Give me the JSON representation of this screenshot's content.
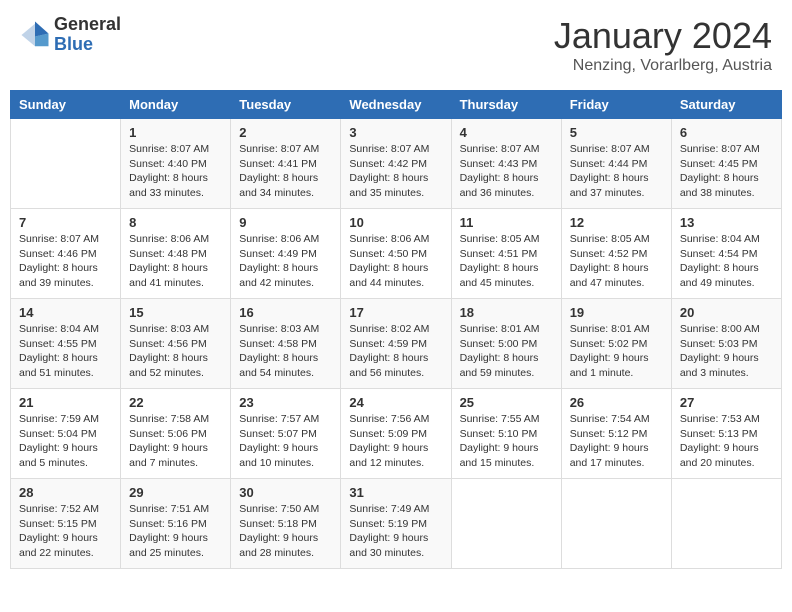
{
  "logo": {
    "general": "General",
    "blue": "Blue"
  },
  "title": "January 2024",
  "location": "Nenzing, Vorarlberg, Austria",
  "headers": [
    "Sunday",
    "Monday",
    "Tuesday",
    "Wednesday",
    "Thursday",
    "Friday",
    "Saturday"
  ],
  "weeks": [
    [
      {
        "day": "",
        "sunrise": "",
        "sunset": "",
        "daylight": ""
      },
      {
        "day": "1",
        "sunrise": "Sunrise: 8:07 AM",
        "sunset": "Sunset: 4:40 PM",
        "daylight": "Daylight: 8 hours and 33 minutes."
      },
      {
        "day": "2",
        "sunrise": "Sunrise: 8:07 AM",
        "sunset": "Sunset: 4:41 PM",
        "daylight": "Daylight: 8 hours and 34 minutes."
      },
      {
        "day": "3",
        "sunrise": "Sunrise: 8:07 AM",
        "sunset": "Sunset: 4:42 PM",
        "daylight": "Daylight: 8 hours and 35 minutes."
      },
      {
        "day": "4",
        "sunrise": "Sunrise: 8:07 AM",
        "sunset": "Sunset: 4:43 PM",
        "daylight": "Daylight: 8 hours and 36 minutes."
      },
      {
        "day": "5",
        "sunrise": "Sunrise: 8:07 AM",
        "sunset": "Sunset: 4:44 PM",
        "daylight": "Daylight: 8 hours and 37 minutes."
      },
      {
        "day": "6",
        "sunrise": "Sunrise: 8:07 AM",
        "sunset": "Sunset: 4:45 PM",
        "daylight": "Daylight: 8 hours and 38 minutes."
      }
    ],
    [
      {
        "day": "7",
        "sunrise": "Sunrise: 8:07 AM",
        "sunset": "Sunset: 4:46 PM",
        "daylight": "Daylight: 8 hours and 39 minutes."
      },
      {
        "day": "8",
        "sunrise": "Sunrise: 8:06 AM",
        "sunset": "Sunset: 4:48 PM",
        "daylight": "Daylight: 8 hours and 41 minutes."
      },
      {
        "day": "9",
        "sunrise": "Sunrise: 8:06 AM",
        "sunset": "Sunset: 4:49 PM",
        "daylight": "Daylight: 8 hours and 42 minutes."
      },
      {
        "day": "10",
        "sunrise": "Sunrise: 8:06 AM",
        "sunset": "Sunset: 4:50 PM",
        "daylight": "Daylight: 8 hours and 44 minutes."
      },
      {
        "day": "11",
        "sunrise": "Sunrise: 8:05 AM",
        "sunset": "Sunset: 4:51 PM",
        "daylight": "Daylight: 8 hours and 45 minutes."
      },
      {
        "day": "12",
        "sunrise": "Sunrise: 8:05 AM",
        "sunset": "Sunset: 4:52 PM",
        "daylight": "Daylight: 8 hours and 47 minutes."
      },
      {
        "day": "13",
        "sunrise": "Sunrise: 8:04 AM",
        "sunset": "Sunset: 4:54 PM",
        "daylight": "Daylight: 8 hours and 49 minutes."
      }
    ],
    [
      {
        "day": "14",
        "sunrise": "Sunrise: 8:04 AM",
        "sunset": "Sunset: 4:55 PM",
        "daylight": "Daylight: 8 hours and 51 minutes."
      },
      {
        "day": "15",
        "sunrise": "Sunrise: 8:03 AM",
        "sunset": "Sunset: 4:56 PM",
        "daylight": "Daylight: 8 hours and 52 minutes."
      },
      {
        "day": "16",
        "sunrise": "Sunrise: 8:03 AM",
        "sunset": "Sunset: 4:58 PM",
        "daylight": "Daylight: 8 hours and 54 minutes."
      },
      {
        "day": "17",
        "sunrise": "Sunrise: 8:02 AM",
        "sunset": "Sunset: 4:59 PM",
        "daylight": "Daylight: 8 hours and 56 minutes."
      },
      {
        "day": "18",
        "sunrise": "Sunrise: 8:01 AM",
        "sunset": "Sunset: 5:00 PM",
        "daylight": "Daylight: 8 hours and 59 minutes."
      },
      {
        "day": "19",
        "sunrise": "Sunrise: 8:01 AM",
        "sunset": "Sunset: 5:02 PM",
        "daylight": "Daylight: 9 hours and 1 minute."
      },
      {
        "day": "20",
        "sunrise": "Sunrise: 8:00 AM",
        "sunset": "Sunset: 5:03 PM",
        "daylight": "Daylight: 9 hours and 3 minutes."
      }
    ],
    [
      {
        "day": "21",
        "sunrise": "Sunrise: 7:59 AM",
        "sunset": "Sunset: 5:04 PM",
        "daylight": "Daylight: 9 hours and 5 minutes."
      },
      {
        "day": "22",
        "sunrise": "Sunrise: 7:58 AM",
        "sunset": "Sunset: 5:06 PM",
        "daylight": "Daylight: 9 hours and 7 minutes."
      },
      {
        "day": "23",
        "sunrise": "Sunrise: 7:57 AM",
        "sunset": "Sunset: 5:07 PM",
        "daylight": "Daylight: 9 hours and 10 minutes."
      },
      {
        "day": "24",
        "sunrise": "Sunrise: 7:56 AM",
        "sunset": "Sunset: 5:09 PM",
        "daylight": "Daylight: 9 hours and 12 minutes."
      },
      {
        "day": "25",
        "sunrise": "Sunrise: 7:55 AM",
        "sunset": "Sunset: 5:10 PM",
        "daylight": "Daylight: 9 hours and 15 minutes."
      },
      {
        "day": "26",
        "sunrise": "Sunrise: 7:54 AM",
        "sunset": "Sunset: 5:12 PM",
        "daylight": "Daylight: 9 hours and 17 minutes."
      },
      {
        "day": "27",
        "sunrise": "Sunrise: 7:53 AM",
        "sunset": "Sunset: 5:13 PM",
        "daylight": "Daylight: 9 hours and 20 minutes."
      }
    ],
    [
      {
        "day": "28",
        "sunrise": "Sunrise: 7:52 AM",
        "sunset": "Sunset: 5:15 PM",
        "daylight": "Daylight: 9 hours and 22 minutes."
      },
      {
        "day": "29",
        "sunrise": "Sunrise: 7:51 AM",
        "sunset": "Sunset: 5:16 PM",
        "daylight": "Daylight: 9 hours and 25 minutes."
      },
      {
        "day": "30",
        "sunrise": "Sunrise: 7:50 AM",
        "sunset": "Sunset: 5:18 PM",
        "daylight": "Daylight: 9 hours and 28 minutes."
      },
      {
        "day": "31",
        "sunrise": "Sunrise: 7:49 AM",
        "sunset": "Sunset: 5:19 PM",
        "daylight": "Daylight: 9 hours and 30 minutes."
      },
      {
        "day": "",
        "sunrise": "",
        "sunset": "",
        "daylight": ""
      },
      {
        "day": "",
        "sunrise": "",
        "sunset": "",
        "daylight": ""
      },
      {
        "day": "",
        "sunrise": "",
        "sunset": "",
        "daylight": ""
      }
    ]
  ]
}
